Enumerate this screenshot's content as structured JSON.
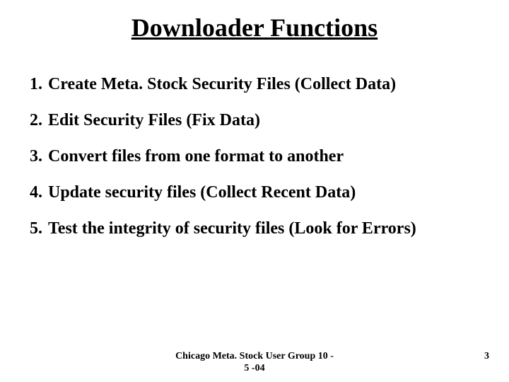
{
  "title": "Downloader Functions",
  "items": [
    {
      "num": "1.",
      "text": "Create Meta. Stock Security Files (Collect Data)"
    },
    {
      "num": "2.",
      "text": "Edit Security Files (Fix Data)"
    },
    {
      "num": "3.",
      "text": "Convert files from one format to another"
    },
    {
      "num": "4.",
      "text": "Update security files (Collect Recent Data)"
    },
    {
      "num": "5.",
      "text": "Test the integrity of security files (Look for Errors)"
    }
  ],
  "footer": {
    "center_line1": "Chicago Meta. Stock User Group 10 -",
    "center_line2": "5 -04",
    "page": "3"
  }
}
